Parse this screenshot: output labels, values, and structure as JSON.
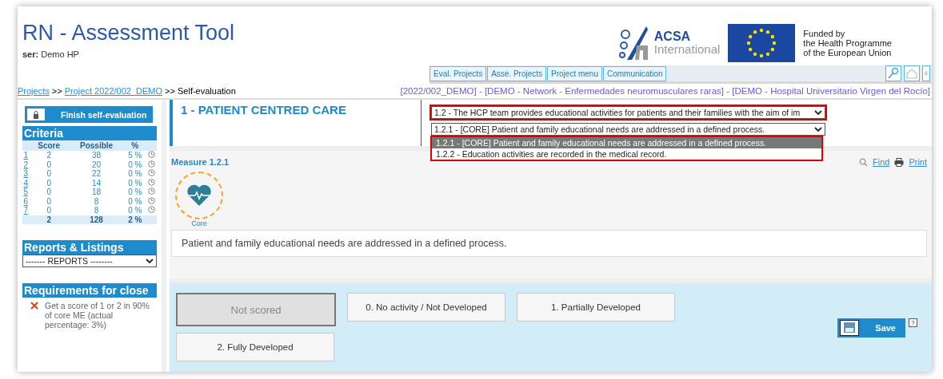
{
  "header": {
    "title": "RN - Assessment Tool",
    "user_label": "ser:",
    "user_name": "Demo HP",
    "logo_name": "ACSA",
    "logo_sub": "International",
    "funding": [
      "Funded by",
      "the Health Programme",
      "of the European Union"
    ]
  },
  "nav": [
    {
      "label": "Eval. Projects",
      "selected": false
    },
    {
      "label": "Asse. Projects",
      "selected": false
    },
    {
      "label": "Project menu",
      "selected": false
    },
    {
      "label": "Communication",
      "selected": false
    }
  ],
  "breadcrumb": {
    "links": [
      "Projects",
      "Project 2022/002_DEMO"
    ],
    "current": ">> Self-evaluation",
    "separator": ">>",
    "context": "[2022/002_DEMO] - [DEMO - Network - Enfermedades neuromusculares raras] - [DEMO - Hospital Universitario Virgen del Rocío]"
  },
  "sidebar": {
    "finish_button": "Finish self-evaluation",
    "criteria_title": "Criteria",
    "criteria_columns": [
      "Score",
      "Possible",
      "%"
    ],
    "criteria_rows": [
      {
        "id": "1",
        "score": "2",
        "possible": "38",
        "percent": "5 %"
      },
      {
        "id": "2",
        "score": "0",
        "possible": "20",
        "percent": "0 %"
      },
      {
        "id": "3",
        "score": "0",
        "possible": "22",
        "percent": "0 %"
      },
      {
        "id": "4",
        "score": "0",
        "possible": "14",
        "percent": "0 %"
      },
      {
        "id": "5",
        "score": "0",
        "possible": "18",
        "percent": "0 %"
      },
      {
        "id": "6",
        "score": "0",
        "possible": "8",
        "percent": "0 %"
      },
      {
        "id": "7",
        "score": "0",
        "possible": "8",
        "percent": "0 %"
      }
    ],
    "criteria_total": {
      "score": "2",
      "possible": "128",
      "percent": "2 %"
    },
    "reports_title": "Reports & Listings",
    "reports_select": "------- REPORTS --------",
    "requirements_title": "Requirements for close",
    "requirements": [
      {
        "text": "Get a score of 1 or 2 in 90% of core ME (actual percentage: 3%)",
        "met": false
      }
    ]
  },
  "main": {
    "section_title": "1 - PATIENT CENTRED CARE",
    "standard_select": "1.2 - The HCP team provides educational activities for patients and their families with the aim of im",
    "measure_select": "1.2.1 - [CORE] Patient and family educational needs are addressed in a defined process.",
    "measure_options": [
      {
        "label": "1.2.1 - [CORE] Patient and family educational needs are addressed in a defined process.",
        "selected": true
      },
      {
        "label": "1.2.2 - Education activities are recorded in the medical record.",
        "selected": false
      }
    ],
    "measure_title": "Measure 1.2.1",
    "find_link": "Find",
    "print_link": "Print",
    "badge_label": "Core",
    "description": "Patient and family educational needs are addressed in a defined process.",
    "scores": [
      {
        "label": "Not scored",
        "selected": true
      },
      {
        "label": "0. No activity / Not Developed",
        "selected": false
      },
      {
        "label": "1. Partially Developed",
        "selected": false
      },
      {
        "label": "2. Fully Developed",
        "selected": false
      }
    ],
    "save_button": "Save",
    "help": "?"
  }
}
